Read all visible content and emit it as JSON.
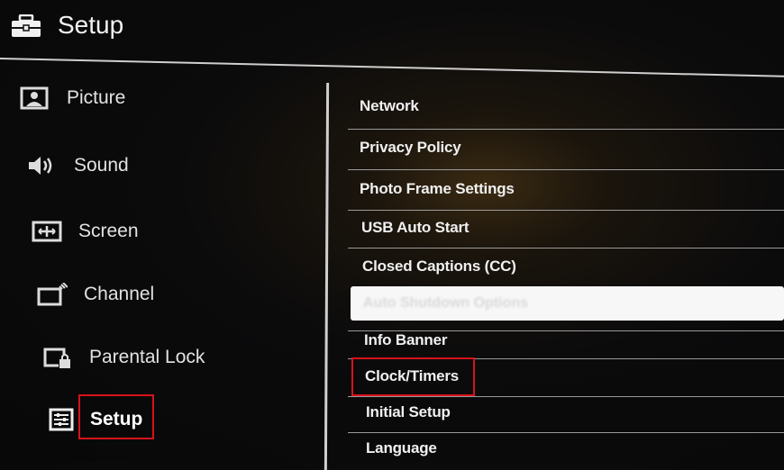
{
  "header": {
    "title": "Setup",
    "icon": "toolbox-icon"
  },
  "sidebar": {
    "items": [
      {
        "label": "Picture",
        "icon": "picture-icon"
      },
      {
        "label": "Sound",
        "icon": "speaker-icon"
      },
      {
        "label": "Screen",
        "icon": "screen-icon"
      },
      {
        "label": "Channel",
        "icon": "channel-icon"
      },
      {
        "label": "Parental Lock",
        "icon": "parental-lock-icon"
      },
      {
        "label": "Setup",
        "icon": "setup-icon",
        "selected": true
      }
    ]
  },
  "menu": {
    "items": [
      {
        "label": "Network"
      },
      {
        "label": "Privacy Policy"
      },
      {
        "label": "Photo Frame Settings"
      },
      {
        "label": "USB Auto Start"
      },
      {
        "label": "Closed Captions (CC)"
      },
      {
        "label": "Auto Shutdown Options",
        "highlighted": true
      },
      {
        "label": "Info Banner"
      },
      {
        "label": "Clock/Timers",
        "annotated": true
      },
      {
        "label": "Initial Setup"
      },
      {
        "label": "Language"
      }
    ]
  },
  "colors": {
    "annotation": "#d8121b",
    "highlight": "#f7f7f7",
    "background": "#080808"
  }
}
